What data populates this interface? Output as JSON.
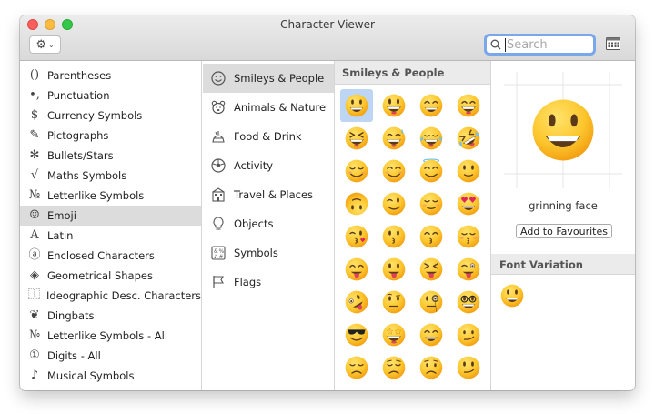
{
  "window": {
    "title": "Character Viewer"
  },
  "search": {
    "placeholder": "Search",
    "value": ""
  },
  "toolbar": {
    "gear": "⚙",
    "chevron": "⌄"
  },
  "categories": [
    {
      "icon": "()",
      "icon_name": "parentheses-icon",
      "label": "Parentheses"
    },
    {
      "icon": "•,",
      "icon_name": "punctuation-icon",
      "label": "Punctuation"
    },
    {
      "icon": "$",
      "icon_name": "dollar-icon",
      "label": "Currency Symbols"
    },
    {
      "icon": "✎",
      "icon_name": "pictograph-icon",
      "label": "Pictographs"
    },
    {
      "icon": "✻",
      "icon_name": "asterisk-icon",
      "label": "Bullets/Stars"
    },
    {
      "icon": "√",
      "icon_name": "square-root-icon",
      "label": "Maths Symbols"
    },
    {
      "icon": "№",
      "icon_name": "numero-icon",
      "label": "Letterlike Symbols"
    },
    {
      "icon": "☺",
      "icon_name": "smiley-icon",
      "label": "Emoji",
      "selected": true
    },
    {
      "icon": "A",
      "icon_name": "latin-a-icon",
      "label": "Latin"
    },
    {
      "icon": "ⓐ",
      "icon_name": "circled-a-icon",
      "label": "Enclosed Characters"
    },
    {
      "icon": "◈",
      "icon_name": "diamond-icon",
      "label": "Geometrical Shapes"
    },
    {
      "icon": "⿰",
      "icon_name": "ideographic-icon",
      "label": "Ideographic Desc. Characters"
    },
    {
      "icon": "❦",
      "icon_name": "dingbat-icon",
      "label": "Dingbats"
    },
    {
      "icon": "№",
      "icon_name": "numero-all-icon",
      "label": "Letterlike Symbols - All"
    },
    {
      "icon": "①",
      "icon_name": "circled-one-icon",
      "label": "Digits - All"
    },
    {
      "icon": "♪",
      "icon_name": "music-note-icon",
      "label": "Musical Symbols"
    }
  ],
  "subcategories": [
    {
      "icon_name": "smiley-icon",
      "label": "Smileys & People",
      "selected": true
    },
    {
      "icon_name": "bear-icon",
      "label": "Animals & Nature"
    },
    {
      "icon_name": "food-icon",
      "label": "Food & Drink"
    },
    {
      "icon_name": "soccer-ball-icon",
      "label": "Activity"
    },
    {
      "icon_name": "building-icon",
      "label": "Travel & Places"
    },
    {
      "icon_name": "lightbulb-icon",
      "label": "Objects"
    },
    {
      "icon_name": "symbols-icon",
      "label": "Symbols"
    },
    {
      "icon_name": "flag-icon",
      "label": "Flags"
    }
  ],
  "grid": {
    "header": "Smileys & People",
    "emojis": [
      {
        "name": "grinning-face",
        "selected": true
      },
      {
        "name": "grinning-face-big-eyes"
      },
      {
        "name": "grinning-face-smiling-eyes"
      },
      {
        "name": "beaming-face"
      },
      {
        "name": "grinning-squinting-face"
      },
      {
        "name": "grinning-face-sweat"
      },
      {
        "name": "face-tears-of-joy"
      },
      {
        "name": "rolling-on-floor-laughing"
      },
      {
        "name": "smiling-face"
      },
      {
        "name": "smiling-face-smiling-eyes"
      },
      {
        "name": "smiling-face-halo"
      },
      {
        "name": "slightly-smiling-face"
      },
      {
        "name": "upside-down-face"
      },
      {
        "name": "winking-face"
      },
      {
        "name": "relieved-face"
      },
      {
        "name": "heart-eyes-face"
      },
      {
        "name": "face-blowing-kiss"
      },
      {
        "name": "kissing-face"
      },
      {
        "name": "kissing-face-smiling-eyes"
      },
      {
        "name": "kissing-face-closed-eyes"
      },
      {
        "name": "face-savoring-food"
      },
      {
        "name": "face-with-tongue"
      },
      {
        "name": "squinting-face-tongue"
      },
      {
        "name": "winking-face-tongue"
      },
      {
        "name": "zany-face"
      },
      {
        "name": "face-raised-eyebrow"
      },
      {
        "name": "face-with-monocle"
      },
      {
        "name": "nerd-face"
      },
      {
        "name": "smiling-face-sunglasses"
      },
      {
        "name": "star-struck"
      },
      {
        "name": "partying-smirk-face"
      },
      {
        "name": "unamused-face"
      },
      {
        "name": "disappointed-face"
      },
      {
        "name": "pensive-face"
      },
      {
        "name": "worried-face"
      },
      {
        "name": "confused-face"
      }
    ]
  },
  "detail": {
    "name": "grinning face",
    "favourite_label": "Add to Favourites",
    "font_variation_header": "Font Variation"
  },
  "colors": {
    "accent": "#7aa7ea",
    "selection": "#bdd6f3",
    "emoji_yellow": "#f7c02b"
  }
}
